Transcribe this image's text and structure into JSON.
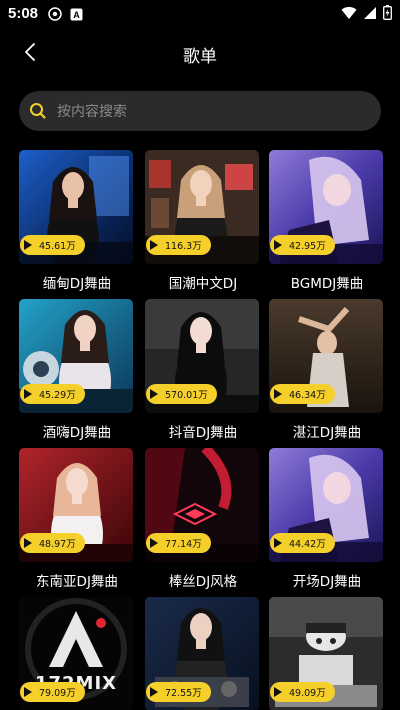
{
  "status": {
    "time": "5:08",
    "left_icons": [
      "dnd-icon",
      "app-a-icon"
    ],
    "right_icons": [
      "wifi-icon",
      "signal-icon",
      "battery-icon"
    ]
  },
  "header": {
    "title": "歌单",
    "back_icon": "chevron-left-icon"
  },
  "search": {
    "placeholder": "按内容搜索",
    "icon_color": "#f5cf2a"
  },
  "colors": {
    "background": "#000000",
    "accent": "#f5cf2a",
    "search_bg": "#2b2b2b"
  },
  "playlists": [
    {
      "title": "缅甸DJ舞曲",
      "plays": "45.61万",
      "cover": "blue-club"
    },
    {
      "title": "国潮中文DJ",
      "plays": "116.3万",
      "cover": "club-gold"
    },
    {
      "title": "BGMDJ舞曲",
      "plays": "42.95万",
      "cover": "purple-dj"
    },
    {
      "title": "酒嗨DJ舞曲",
      "plays": "45.29万",
      "cover": "cyan-dj"
    },
    {
      "title": "抖音DJ舞曲",
      "plays": "570.01万",
      "cover": "dark-portrait"
    },
    {
      "title": "湛江DJ舞曲",
      "plays": "46.34万",
      "cover": "dancer-brown"
    },
    {
      "title": "东南亚DJ舞曲",
      "plays": "48.97万",
      "cover": "pink-red"
    },
    {
      "title": "棒丝DJ风格",
      "plays": "77.14万",
      "cover": "neon-red"
    },
    {
      "title": "开场DJ舞曲",
      "plays": "44.42万",
      "cover": "purple-dj"
    },
    {
      "title": "",
      "plays": "79.09万",
      "cover": "mix-logo",
      "logo_text": "172MIX"
    },
    {
      "title": "",
      "plays": "72.55万",
      "cover": "dj-blue"
    },
    {
      "title": "",
      "plays": "49.09万",
      "cover": "cartoon-dj"
    }
  ]
}
